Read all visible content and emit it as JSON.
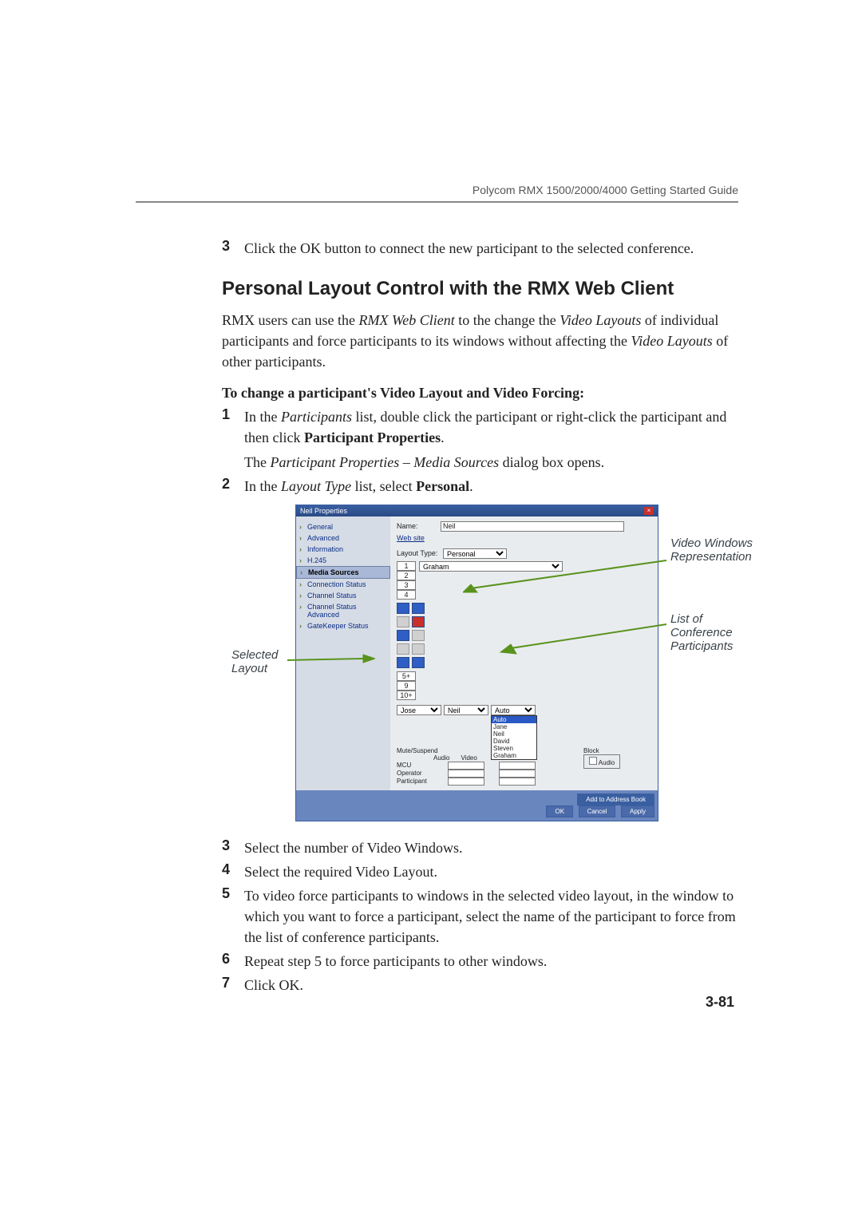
{
  "header": {
    "title": "Polycom RMX 1500/2000/4000 Getting Started Guide"
  },
  "intro_step": {
    "num": "3",
    "text": "Click the OK button to connect the new participant to the selected conference."
  },
  "section_title": "Personal Layout Control with the RMX Web Client",
  "para1_pre": "RMX users can use the ",
  "para1_i1": "RMX Web Client",
  "para1_mid": " to the change the ",
  "para1_i2": "Video Layouts",
  "para1_mid2": " of individual participants and force participants to its windows without affecting the ",
  "para1_i3": "Video Layouts",
  "para1_end": " of other participants.",
  "lead": "To change a participant's Video Layout and Video Forcing:",
  "steps": [
    {
      "num": "1",
      "pre": "In the ",
      "i": "Participants",
      "mid": " list, double click the participant or right-click the participant and then click ",
      "b": "Participant Properties",
      "end": "."
    },
    {
      "num": "",
      "pre": "The ",
      "i": "Participant Properties – Media Sources",
      "mid": " dialog box opens.",
      "b": "",
      "end": ""
    },
    {
      "num": "2",
      "pre": "In the ",
      "i": "Layout Type",
      "mid": " list, select ",
      "b": "Personal",
      "end": "."
    }
  ],
  "post_steps": [
    {
      "num": "3",
      "text": "Select the number of Video Windows."
    },
    {
      "num": "4",
      "text": "Select the required Video Layout."
    },
    {
      "num": "5",
      "text": "To video force participants to windows in the selected video layout, in the window to which you want to force a participant, select the name of the participant to force from the list of conference participants."
    },
    {
      "num": "6",
      "text": "Repeat step 5 to force participants to other windows."
    },
    {
      "num": "7",
      "text": "Click OK."
    }
  ],
  "dialog": {
    "title": "Neil Properties",
    "nav": [
      "General",
      "Advanced",
      "Information",
      "H.245",
      "Media Sources",
      "Connection Status",
      "Channel Status",
      "Channel Status Advanced",
      "GateKeeper Status"
    ],
    "nav_selected": "Media Sources",
    "name_label": "Name:",
    "name_value": "Neil",
    "website": "Web site",
    "layout_type_label": "Layout Type:",
    "layout_type_value": "Personal",
    "win_counts": [
      "1",
      "2",
      "3",
      "4"
    ],
    "win_counts_more": [
      "5+",
      "9",
      "10+"
    ],
    "selectors": [
      "Jose",
      "Neil",
      "Auto"
    ],
    "dropdown": [
      "Auto",
      "Jane",
      "Neil",
      "David",
      "Steven",
      "Graham"
    ],
    "mute_header": "Mute/Suspend",
    "mute_cols": [
      "Audio",
      "Video"
    ],
    "mute_rows": [
      "MCU",
      "Operator",
      "Participant"
    ],
    "block_label": "Block",
    "block_audio": "Audio",
    "btn_addr": "Add to Address Book",
    "btn_ok": "OK",
    "btn_cancel": "Cancel",
    "btn_apply": "Apply"
  },
  "callouts": {
    "left": "Selected Layout",
    "right1": "Video Windows Representation",
    "right2": "List of Conference Participants"
  },
  "page_number": "3-81"
}
